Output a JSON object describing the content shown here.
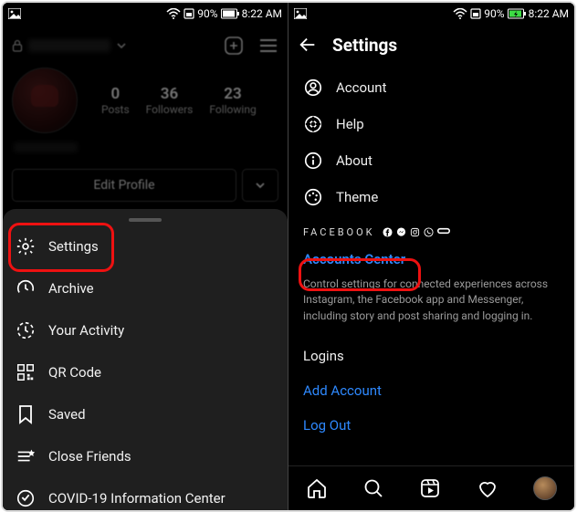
{
  "status": {
    "battery_pct": "90%",
    "time": "8:22 AM"
  },
  "left": {
    "stats": {
      "posts_num": "0",
      "posts_lbl": "Posts",
      "followers_num": "36",
      "followers_lbl": "Followers",
      "following_num": "23",
      "following_lbl": "Following"
    },
    "edit_profile": "Edit Profile",
    "menu": {
      "settings": "Settings",
      "archive": "Archive",
      "activity": "Your Activity",
      "qr": "QR Code",
      "saved": "Saved",
      "close_friends": "Close Friends",
      "covid": "COVID-19 Information Center"
    }
  },
  "right": {
    "title": "Settings",
    "items": {
      "account": "Account",
      "help": "Help",
      "about": "About",
      "theme": "Theme"
    },
    "fb_label": "FACEBOOK",
    "accounts_center": "Accounts Center",
    "ac_desc": "Control settings for connected experiences across Instagram, the Facebook app and Messenger, including story and post sharing and logging in.",
    "logins_header": "Logins",
    "add_account": "Add Account",
    "log_out": "Log Out"
  }
}
